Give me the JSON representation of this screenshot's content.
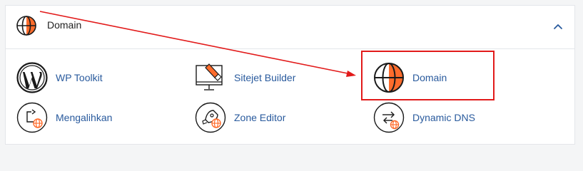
{
  "section": {
    "title": "Domain",
    "header_icon": "globe-icon",
    "collapse_icon": "chevron-up-icon"
  },
  "items": [
    {
      "label": "WP Toolkit",
      "icon": "wordpress-icon"
    },
    {
      "label": "Sitejet Builder",
      "icon": "monitor-brush-icon"
    },
    {
      "label": "Domain",
      "icon": "globe-icon"
    },
    {
      "label": "Mengalihkan",
      "icon": "redirect-globe-icon"
    },
    {
      "label": "Zone Editor",
      "icon": "rocket-globe-icon"
    },
    {
      "label": "Dynamic DNS",
      "icon": "swap-arrows-globe-icon"
    }
  ],
  "colors": {
    "link": "#295a9d",
    "accent": "#ff6c2c",
    "annotation": "#e21a1a",
    "border": "#e4e6ea"
  }
}
